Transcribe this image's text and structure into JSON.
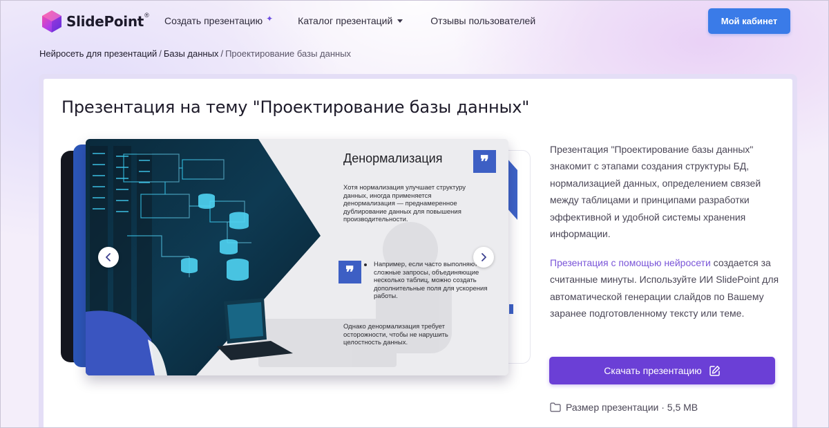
{
  "header": {
    "logo_text": "SlidePoint",
    "logo_reg": "®",
    "nav": {
      "create": "Создать презентацию",
      "catalog": "Каталог презентаций",
      "reviews": "Отзывы пользователей"
    },
    "cabinet_button": "Мой кабинет"
  },
  "breadcrumb": {
    "items": [
      "Нейросеть для презентаций",
      "Базы данных"
    ],
    "separator": "/",
    "current": "Проектирование базы данных"
  },
  "page": {
    "title": "Презентация на тему \"Проектирование базы данных\""
  },
  "slide": {
    "title": "Денормализация",
    "paragraph1": "Хотя нормализация улучшает структуру данных, иногда применяется денормализация — преднамеренное дублирование данных для повышения производительности.",
    "paragraph2": "Например, если часто выполняются сложные запросы, объединяющие несколько таблиц, можно создать дополнительные поля для ускорения работы.",
    "paragraph3": "Однако денормализация требует осторожности, чтобы не нарушить целостность данных.",
    "quote_glyph": "❞"
  },
  "description": {
    "paragraph1": "Презентация \"Проектирование базы данных\" знакомит с этапами создания структуры БД, нормализацией данных, определением связей между таблицами и принципами разработки эффективной и удобной системы хранения информации.",
    "ai_link": "Презентация с помощью нейросети",
    "paragraph2_rest": " создается за считанные минуты. Используйте ИИ SlidePoint для автоматической генерации слайдов по Вашему заранее подготовленному тексту или теме."
  },
  "download_button": "Скачать презентацию",
  "size": {
    "label": "Размер презентации",
    "separator": " · ",
    "value": "5,5 MB"
  },
  "colors": {
    "primary_blue": "#3a7be8",
    "accent_purple": "#6b3fd6",
    "link_purple": "#7a55d8",
    "slide_blue": "#3d5fc4"
  },
  "icons": [
    "logo-gem-icon",
    "sparkle-icon",
    "caret-down-icon",
    "chevron-left-icon",
    "chevron-right-icon",
    "quote-icon",
    "edit-icon",
    "folder-icon"
  ]
}
